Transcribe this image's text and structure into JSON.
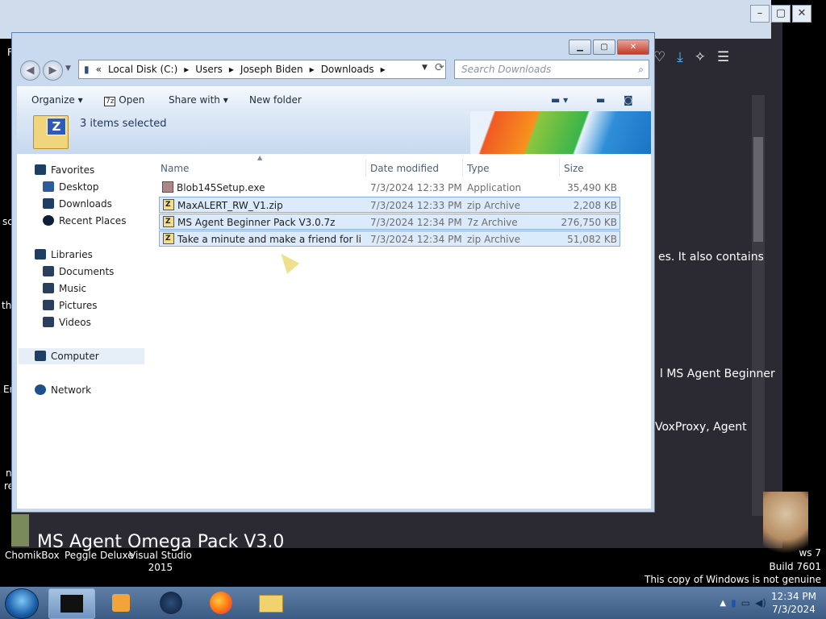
{
  "browser": {
    "page_heading": "MS Agent Omega Pack V3.0",
    "text_lines": [
      "es. It also contains",
      "l MS Agent Beginner",
      "VoxProxy, Agent"
    ],
    "left_fragments": [
      "F",
      "sc",
      "th",
      "Er",
      "n",
      "re"
    ]
  },
  "explorer": {
    "breadcrumb": [
      "Local Disk (C:)",
      "Users",
      "Joseph Biden",
      "Downloads"
    ],
    "search_placeholder": "Search Downloads",
    "commands": {
      "organize": "Organize",
      "open": "Open",
      "share_with": "Share with",
      "new_folder": "New folder"
    },
    "selection_info": "3 items selected",
    "nav": {
      "favorites": "Favorites",
      "desktop": "Desktop",
      "downloads": "Downloads",
      "recent_places": "Recent Places",
      "libraries": "Libraries",
      "documents": "Documents",
      "music": "Music",
      "pictures": "Pictures",
      "videos": "Videos",
      "computer": "Computer",
      "network": "Network"
    },
    "columns": {
      "name": "Name",
      "date": "Date modified",
      "type": "Type",
      "size": "Size"
    },
    "files": [
      {
        "name": "Blob145Setup.exe",
        "date": "7/3/2024 12:33 PM",
        "type": "Application",
        "size": "35,490 KB",
        "selected": false
      },
      {
        "name": "MaxALERT_RW_V1.zip",
        "date": "7/3/2024 12:33 PM",
        "type": "zip Archive",
        "size": "2,208 KB",
        "selected": true
      },
      {
        "name": "MS Agent Beginner Pack V3.0.7z",
        "date": "7/3/2024 12:34 PM",
        "type": "7z Archive",
        "size": "276,750 KB",
        "selected": true
      },
      {
        "name": "Take a minute and make a friend for life!....",
        "date": "7/3/2024 12:34 PM",
        "type": "zip Archive",
        "size": "51,082 KB",
        "selected": true
      }
    ]
  },
  "desktop": {
    "icons": [
      "ChomikBox",
      "Peggle Deluxe",
      "Visual Studio\n2015"
    ],
    "watermark": {
      "line1": "ws 7",
      "line2": "Build 7601",
      "line3": "This copy of Windows is not genuine"
    }
  },
  "taskbar": {
    "time": "12:34 PM",
    "date": "7/3/2024"
  },
  "colors": {
    "selection": "#dcebfc",
    "selection_border": "#84acdd",
    "taskbar": "#4d6d96"
  }
}
